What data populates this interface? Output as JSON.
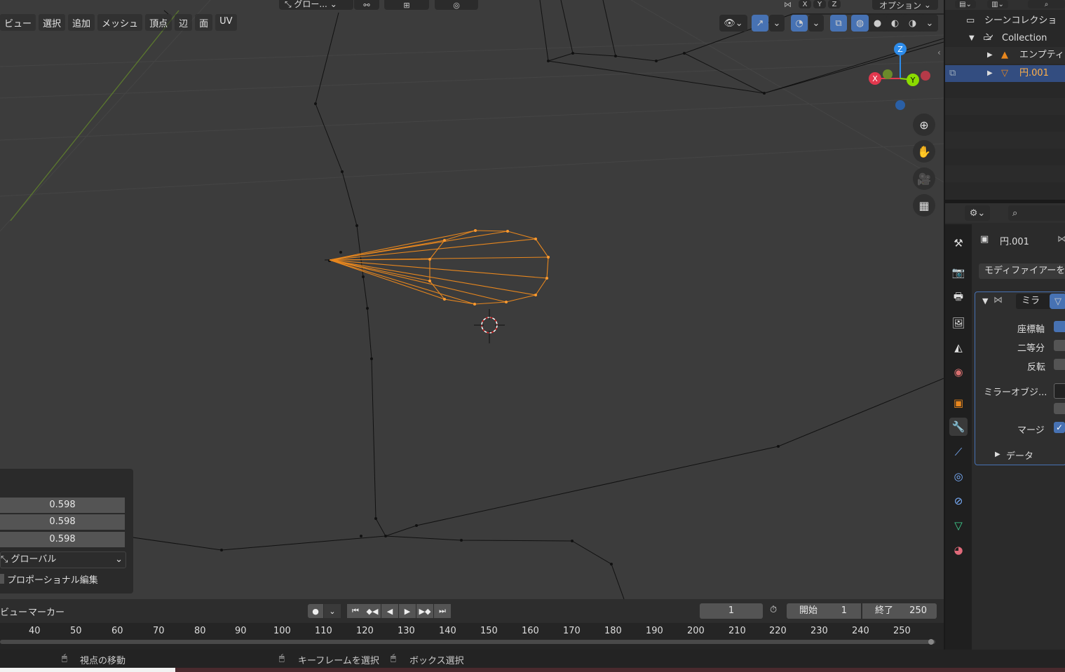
{
  "header": {
    "menu": [
      "ビュー",
      "選択",
      "追加",
      "メッシュ",
      "頂点",
      "辺",
      "面",
      "UV"
    ],
    "transform_orientation": "グロー...",
    "options_label": "オプション",
    "mirror_axes": [
      "X",
      "Y",
      "Z"
    ]
  },
  "gizmo": {
    "x": "X",
    "y": "Y",
    "z": "Z"
  },
  "redo_panel": {
    "values": [
      "0.598",
      "0.598",
      "0.598"
    ],
    "orientation": "グローバル",
    "proportional": "プロポーショナル編集"
  },
  "timeline": {
    "menu": [
      "ビュー",
      "マーカー"
    ],
    "current_frame": "1",
    "start_label": "開始",
    "start_value": "1",
    "end_label": "終了",
    "end_value": "250",
    "ruler": [
      "40",
      "50",
      "60",
      "70",
      "80",
      "90",
      "100",
      "110",
      "120",
      "130",
      "140",
      "150",
      "160",
      "170",
      "180",
      "190",
      "200",
      "210",
      "220",
      "230",
      "240",
      "250"
    ]
  },
  "status": {
    "move_view": "視点の移動",
    "select_keyframe": "キーフレームを選択",
    "box_select": "ボックス選択"
  },
  "outliner": {
    "scene_collection": "シーンコレクション",
    "collection": "Collection",
    "empty": "エンプティ",
    "object": "円.001"
  },
  "properties": {
    "object_name": "円.001",
    "add_modifier": "モディファイアーを",
    "modifier_name": "ミラ",
    "axis_label": "座標軸",
    "bisect_label": "二等分",
    "flip_label": "反転",
    "mirror_object_label": "ミラーオブジ...",
    "merge_label": "マージ",
    "data_label": "データ"
  },
  "colors": {
    "accent": "#4772b3",
    "selected_wire": "#e8871e",
    "viewport_bg": "#3c3c3c",
    "x_axis": "#e2384e",
    "y_axis": "#8bdc00",
    "z_axis": "#2d8ceb"
  }
}
